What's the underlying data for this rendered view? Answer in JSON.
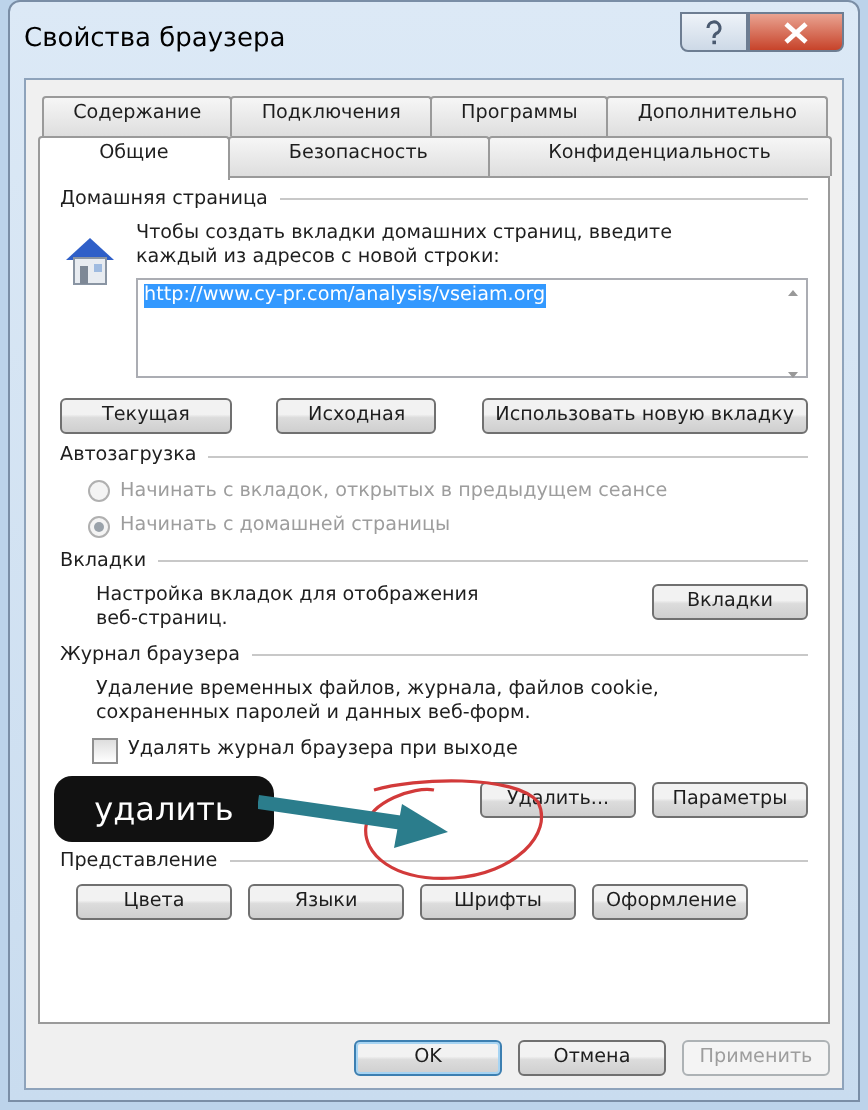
{
  "window": {
    "title": "Свойства браузера"
  },
  "tab_rows": [
    [
      {
        "label": "Содержание",
        "selected": false
      },
      {
        "label": "Подключения",
        "selected": false
      },
      {
        "label": "Программы",
        "selected": false
      },
      {
        "label": "Дополнительно",
        "selected": false
      }
    ],
    [
      {
        "label": "Общие",
        "selected": true
      },
      {
        "label": "Безопасность",
        "selected": false
      },
      {
        "label": "Конфиденциальность",
        "selected": false
      }
    ]
  ],
  "home_page": {
    "heading": "Домашняя страница",
    "description": "Чтобы создать вкладки домашних страниц, введите каждый из адресов с новой строки:",
    "url": "http://www.cy-pr.com/analysis/vseiam.org",
    "buttons": [
      "Текущая",
      "Исходная",
      "Использовать новую вкладку"
    ]
  },
  "startup": {
    "heading": "Автозагрузка",
    "options": [
      {
        "label": "Начинать с вкладок, открытых в предыдущем сеансе",
        "selected": false,
        "disabled": true
      },
      {
        "label": "Начинать с домашней страницы",
        "selected": true,
        "disabled": true
      }
    ]
  },
  "tabs_section": {
    "heading": "Вкладки",
    "description": "Настройка вкладок для отображения веб-страниц.",
    "button": "Вкладки"
  },
  "history": {
    "heading": "Журнал браузера",
    "description": "Удаление временных файлов, журнала, файлов cookie, сохраненных паролей и данных веб-форм.",
    "checkbox": {
      "label": "Удалять журнал браузера при выходе",
      "checked": false
    },
    "buttons": [
      "Удалить...",
      "Параметры"
    ]
  },
  "appearance": {
    "heading": "Представление",
    "buttons": [
      "Цвета",
      "Языки",
      "Шрифты",
      "Оформление"
    ]
  },
  "annotation": {
    "label": "удалить"
  },
  "footer_buttons": [
    {
      "label": "OK",
      "disabled": false,
      "default": true
    },
    {
      "label": "Отмена",
      "disabled": false,
      "default": false
    },
    {
      "label": "Применить",
      "disabled": true,
      "default": false
    }
  ]
}
